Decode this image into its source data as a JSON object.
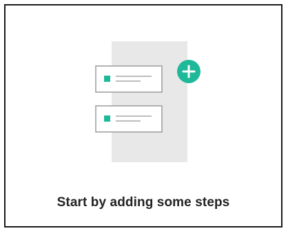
{
  "empty_state": {
    "message": "Start by adding some steps"
  },
  "colors": {
    "accent": "#1fb99a",
    "panel": "#e8e8e8",
    "step_border": "#9a9a9a",
    "text": "#222222"
  },
  "icons": [
    "add-step-icon",
    "step-placeholder-icon"
  ]
}
